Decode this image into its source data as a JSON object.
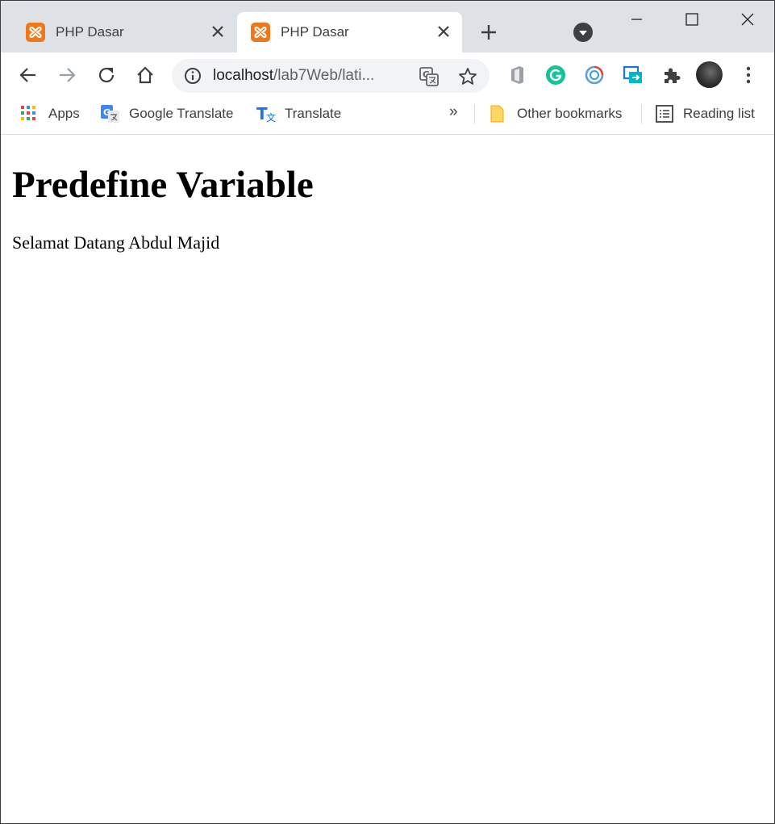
{
  "browser": {
    "tabs": [
      {
        "label": "PHP Dasar",
        "active": false,
        "favicon": "xampp-icon"
      },
      {
        "label": "PHP Dasar",
        "active": true,
        "favicon": "xampp-icon"
      }
    ],
    "address_bar": {
      "host": "localhost",
      "path": "/lab7Web/lati..."
    },
    "bookmarks": {
      "items": [
        {
          "label": "Apps",
          "icon": "apps-grid-icon"
        },
        {
          "label": "Google Translate",
          "icon": "google-translate-icon"
        },
        {
          "label": "Translate",
          "icon": "translate-icon"
        }
      ],
      "overflow": "»",
      "other_bookmarks": "Other bookmarks",
      "reading_list": "Reading list"
    },
    "colors": {
      "tabstrip": "#dee1e6",
      "favicon": "#f0781a",
      "grammarly": "#15c39a",
      "accent_blue": "#1a73e8"
    }
  },
  "page": {
    "heading": "Predefine Variable",
    "text": "Selamat Datang Abdul Majid"
  }
}
